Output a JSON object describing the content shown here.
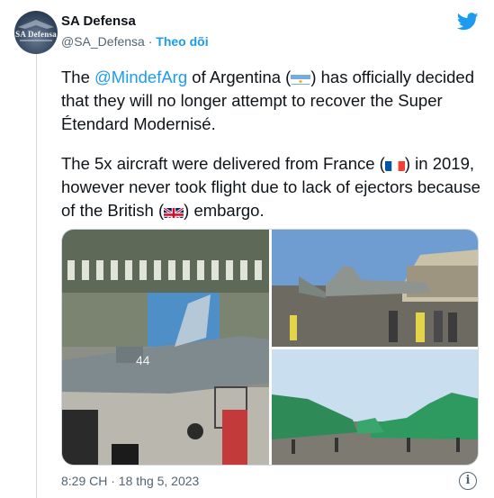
{
  "account": {
    "name": "SA Defensa",
    "handle": "@SA_Defensa",
    "separator": "·",
    "follow_label": "Theo dõi",
    "avatar_text": "SA Defensa"
  },
  "icons": {
    "brand": "twitter-bird-icon",
    "info": "info-icon",
    "flag_argentina": "argentina-flag-icon",
    "flag_france": "france-flag-icon",
    "flag_uk": "uk-flag-icon"
  },
  "tweet": {
    "p1_pre": "The ",
    "p1_mention": "@MindefArg",
    "p1_mid": " of Argentina (",
    "p1_post": ") has officially decided that they will no longer attempt to recover the Super Étendard Modernisé.",
    "p2_a": "The 5x aircraft were delivered from France (",
    "p2_b": ") in 2019, however never took flight due to lack of ejectors because of the British (",
    "p2_c": ") embargo."
  },
  "timestamp": "8:29 CH · 18 thg 5, 2023",
  "info_glyph": "i",
  "colors": {
    "link": "#1d9bf0",
    "text": "#0f1419",
    "muted": "#536471",
    "border": "#cfd9de"
  }
}
